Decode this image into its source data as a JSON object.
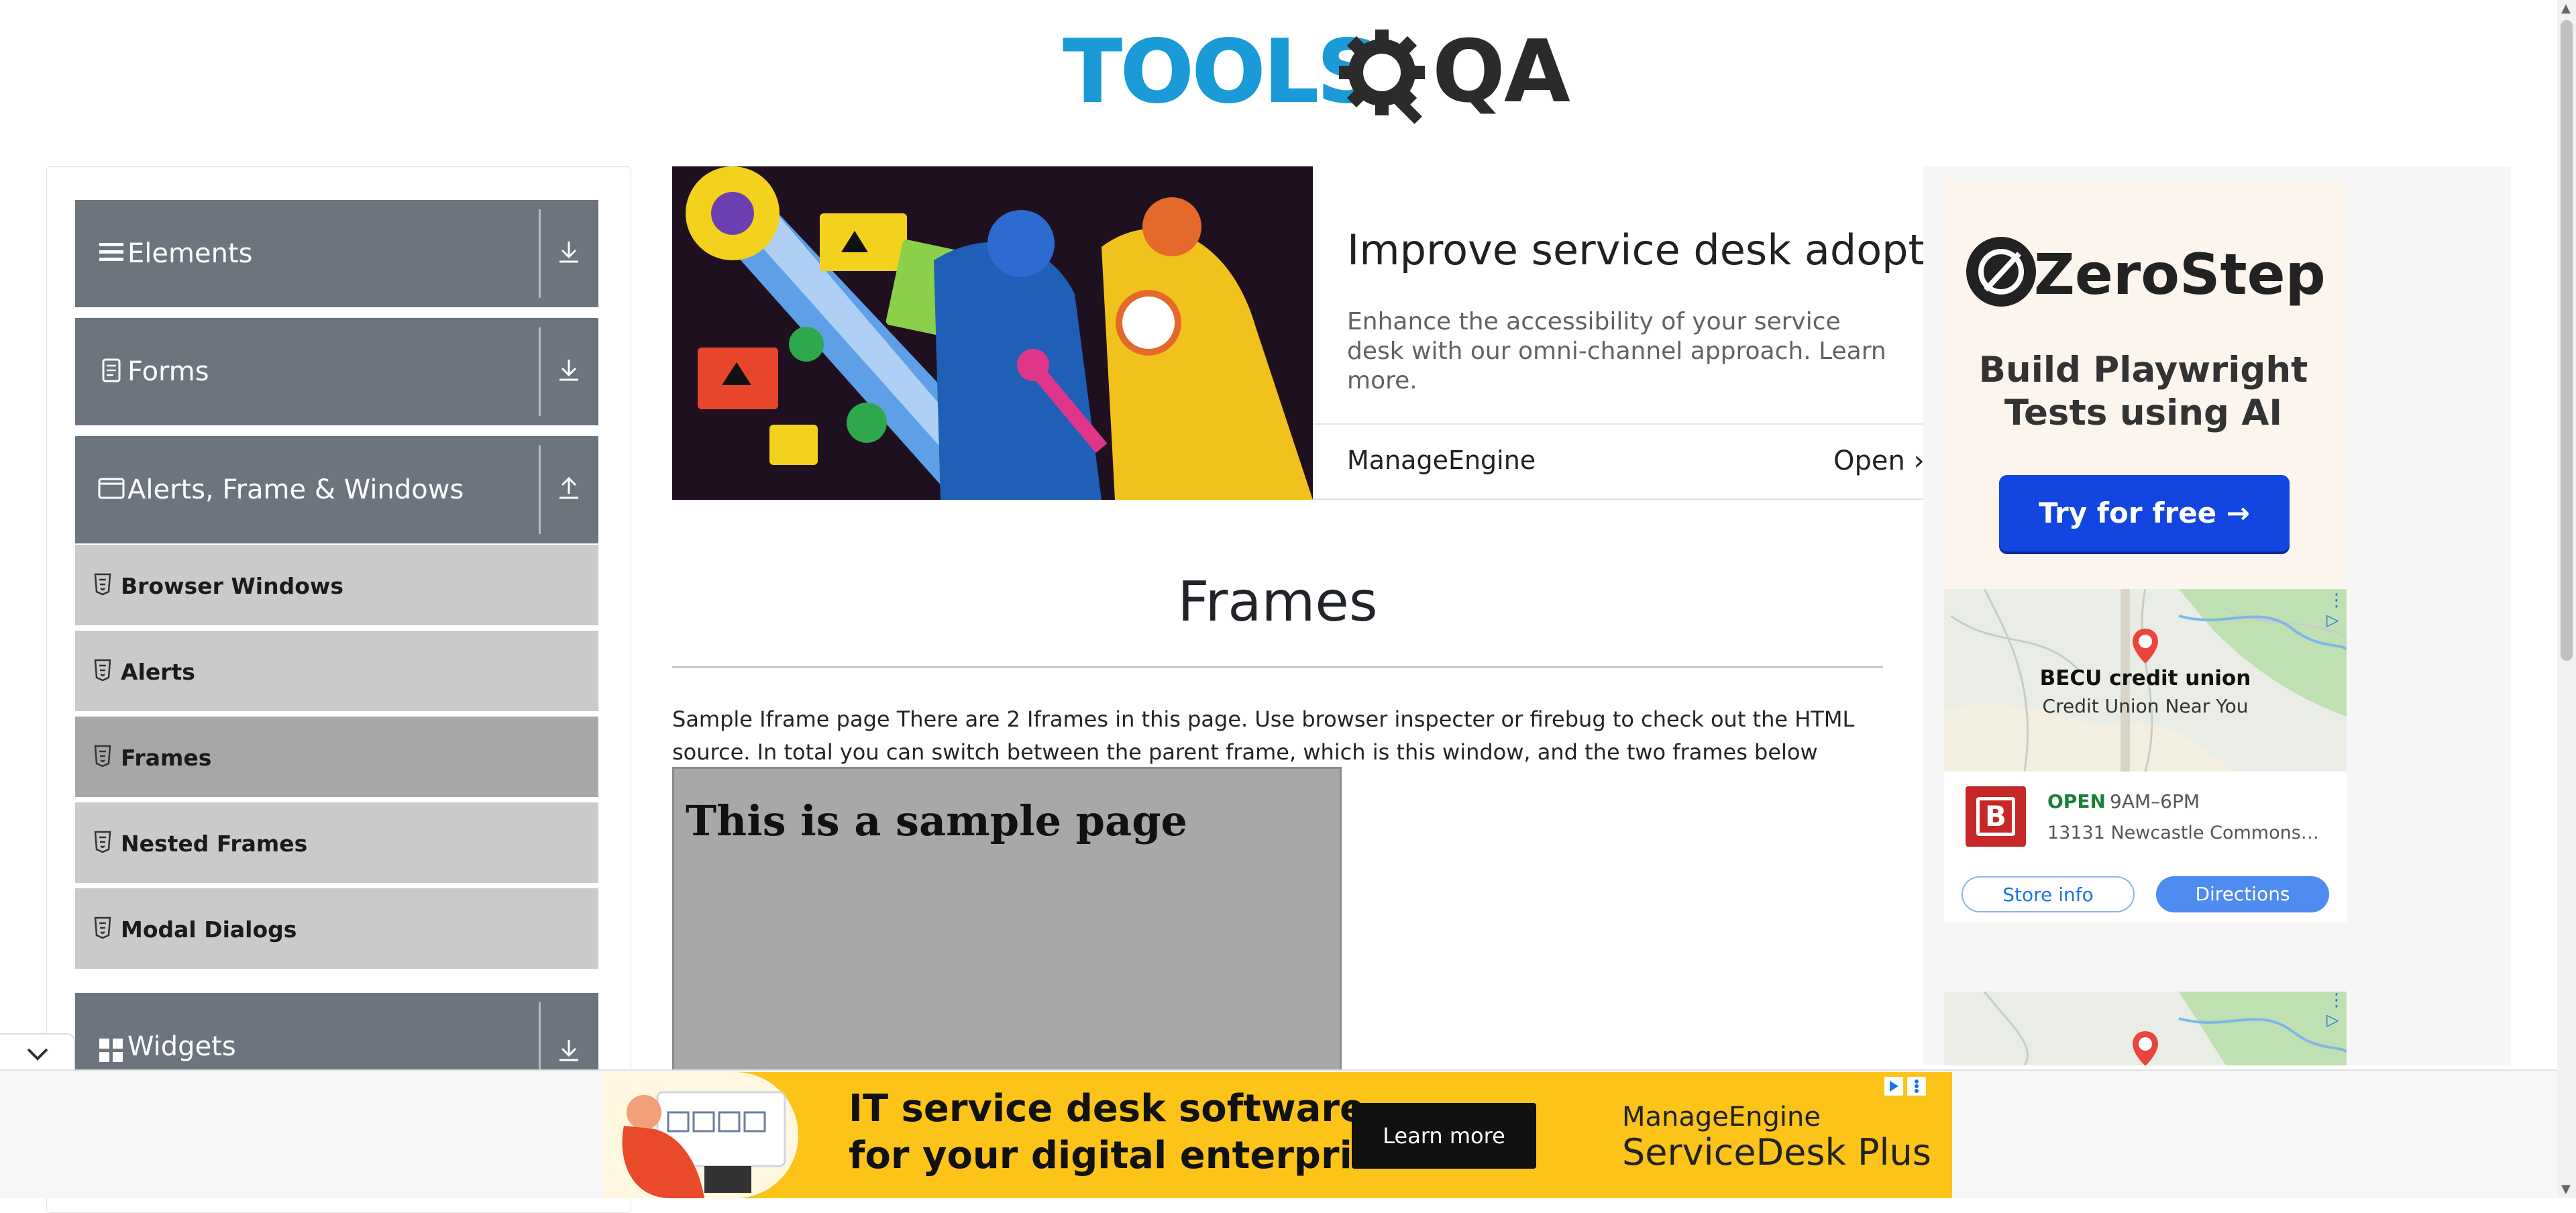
{
  "header": {
    "logo_part1": "TOOLS",
    "logo_part2": "QA",
    "brand_colors": {
      "tools": "#1a9ad6",
      "qa": "#2b2b2b"
    }
  },
  "sidebar": {
    "groups": [
      {
        "label": "Elements",
        "icon": "hamburger-icon",
        "toggle_icon": "download-icon"
      },
      {
        "label": "Forms",
        "icon": "document-icon",
        "toggle_icon": "download-icon"
      },
      {
        "label": "Alerts, Frame & Windows",
        "icon": "window-icon",
        "toggle_icon": "upload-icon"
      },
      {
        "label": "Widgets",
        "icon": "grid-icon",
        "toggle_icon": "download-icon"
      }
    ],
    "items": [
      {
        "label": "Browser Windows",
        "active": false
      },
      {
        "label": "Alerts",
        "active": false
      },
      {
        "label": "Frames",
        "active": true
      },
      {
        "label": "Nested Frames",
        "active": false
      },
      {
        "label": "Modal Dialogs",
        "active": false
      }
    ]
  },
  "banner_ad": {
    "title": "Improve service desk adoption",
    "description": "Enhance the accessibility of your service desk with our omni-channel approach. Learn more.",
    "brand": "ManageEngine",
    "cta": "Open"
  },
  "main": {
    "title": "Frames",
    "description": "Sample Iframe page There are 2 Iframes in this page. Use browser inspecter or firebug to check out the HTML source. In total you can switch between the parent frame, which is this window, and the two frames below",
    "iframe_heading": "This is a sample page"
  },
  "right_ad": {
    "brand": "ZeroStep",
    "subtitle": "Build Playwright Tests using AI",
    "cta": "Try for free →",
    "map_place": "BECU credit union",
    "map_sub": "Credit Union Near You",
    "status": "OPEN",
    "hours": "9AM–6PM",
    "address": "13131 Newcastle Commons…",
    "store_info": "Store info",
    "directions": "Directions",
    "colors": {
      "cta": "#1346e0",
      "open": "#188038",
      "directions": "#4e8cf0"
    }
  },
  "bottom_ad": {
    "headline_line1": "IT service desk software",
    "headline_line2": "for your digital enterprise",
    "cta": "Learn more",
    "brand_line1": "ManageEngine",
    "brand_line2": "ServiceDesk Plus",
    "color": "#fcc419"
  }
}
